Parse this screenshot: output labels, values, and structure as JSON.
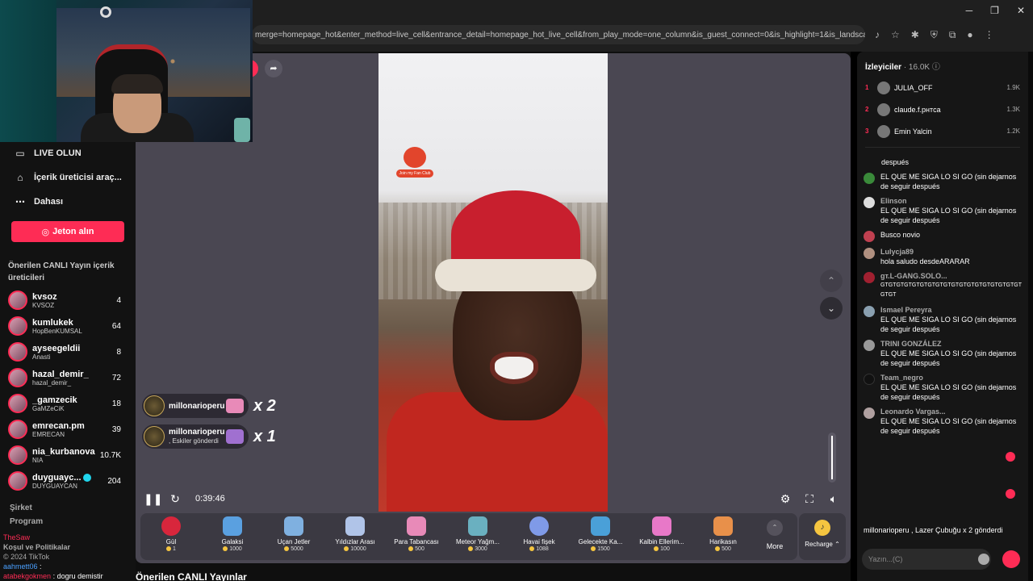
{
  "browser": {
    "url": "merge=homepage_hot&enter_method=live_cell&entrance_detail=homepage_hot_live_cell&from_play_mode=one_column&is_guest_connect=0&is_highlight=1&is_landscape=0&r..."
  },
  "sidebar": {
    "nav": [
      {
        "label": "LIVE OLUN",
        "icon": "camera-icon"
      },
      {
        "label": "İçerik üreticisi araç...",
        "icon": "creator-tools-icon"
      },
      {
        "label": "Dahası",
        "icon": "more-dots-icon"
      }
    ],
    "coin_button": "Jeton alın",
    "section_title": "Önerilen CANLI Yayın içerik üreticileri",
    "creators": [
      {
        "name": "kvsoz",
        "sub": "KVSOZ",
        "count": "4"
      },
      {
        "name": "kumlukek",
        "sub": "HopBenKUMSAL",
        "count": "64"
      },
      {
        "name": "ayseegeldii",
        "sub": "Anasti",
        "count": "8"
      },
      {
        "name": "hazal_demir_",
        "sub": "hazal_demir_",
        "count": "72"
      },
      {
        "name": "_gamzecik",
        "sub": "GaMZeCiK",
        "count": "18"
      },
      {
        "name": "emrecan.pm",
        "sub": "EMRECAN",
        "count": "39"
      },
      {
        "name": "nia_kurbanova",
        "sub": "NIA",
        "count": "10.7K"
      },
      {
        "name": "duyguayc...",
        "sub": "DUYGUAYCAN",
        "count": "204",
        "verified": true
      }
    ],
    "footer": [
      "Şirket",
      "Program"
    ],
    "overlay_lines": [
      {
        "user": "TheSaw",
        "text": ""
      },
      {
        "user": "Koşul ve Politikalar",
        "text": ""
      },
      {
        "user": "© 2024 TikTok",
        "text": ""
      },
      {
        "user": "aahmett06",
        "text": ":"
      },
      {
        "user": "atabekgokmen",
        "text": ": dogru demistir"
      }
    ]
  },
  "player": {
    "time": "0:39:46",
    "video_badge": "Join my Fan Club",
    "gift_notifications": [
      {
        "user": "millonarioperu",
        "sub": "",
        "count": "x 2"
      },
      {
        "user": "millonarioperu",
        "sub": ", Eskiler gönderdi",
        "count": "x 1"
      }
    ]
  },
  "gifts": [
    {
      "name": "Gül",
      "price": "1",
      "color": "#d8263c"
    },
    {
      "name": "Galaksi",
      "price": "1000",
      "color": "#5aa0e0"
    },
    {
      "name": "Uçan Jetler",
      "price": "5000",
      "color": "#7fb0e0"
    },
    {
      "name": "Yıldızlar Arası",
      "price": "10000",
      "color": "#b0c4e8"
    },
    {
      "name": "Para Tabancası",
      "price": "500",
      "color": "#e88ab8"
    },
    {
      "name": "Meteor Yağm...",
      "price": "3000",
      "color": "#6ab0c0"
    },
    {
      "name": "Havai fişek",
      "price": "1088",
      "color": "#7f9ae8"
    },
    {
      "name": "Gelecekte Ka...",
      "price": "1500",
      "color": "#4aa0d8"
    },
    {
      "name": "Kalbin Ellerim...",
      "price": "100",
      "color": "#e878c8"
    },
    {
      "name": "Harikasın",
      "price": "500",
      "color": "#e8904a"
    }
  ],
  "more_label": "More",
  "recharge_label": "Recharge",
  "bottom_title": "Önerilen CANLI Yayınlar",
  "chat": {
    "viewers_title": "İzleyiciler",
    "viewers_count": "· 16.0K",
    "top_viewers": [
      {
        "rank": "1",
        "name": "JULIA_OFF",
        "score": "1.9K"
      },
      {
        "rank": "2",
        "name": "claude.f.pнтca",
        "score": "1.3K"
      },
      {
        "rank": "3",
        "name": "Emin Yalcin",
        "score": "1.2K"
      }
    ],
    "messages": [
      {
        "name": "",
        "text": "después"
      },
      {
        "name": "",
        "text": "EL QUE ME SIGA LO SI GO (sin dejarnos de seguir después"
      },
      {
        "name": "Elinson",
        "text": "EL QUE ME SIGA LO SI GO (sin dejarnos de seguir después"
      },
      {
        "name": "",
        "text": "Busco novio"
      },
      {
        "name": "Lulycja89",
        "text": "hola saludo desdeARARAR"
      },
      {
        "name": "gт.L-GANG.SOLO...",
        "text": "GTGTGTGTGTGTGTGTGTGTGTGTGTGTGTGTGTGTGTGT"
      },
      {
        "name": "Ismael Pereyra",
        "text": "EL QUE ME SIGA LO SI GO (sin dejarnos de seguir después"
      },
      {
        "name": "TRINI GONZÁLEZ",
        "text": "EL QUE ME SIGA LO SI GO (sin dejarnos de seguir después"
      },
      {
        "name": "Team_negro",
        "text": "EL QUE ME SIGA LO SI GO (sin dejarnos de seguir después"
      },
      {
        "name": "Leonardo Vargas...",
        "text": "EL QUE ME SIGA LO SI GO (sin dejarnos de seguir después"
      }
    ],
    "gift_notice": "millonarioperu , Lazer Çubuğu x 2 gönderdi",
    "input_placeholder": "Yazın...(C)"
  }
}
